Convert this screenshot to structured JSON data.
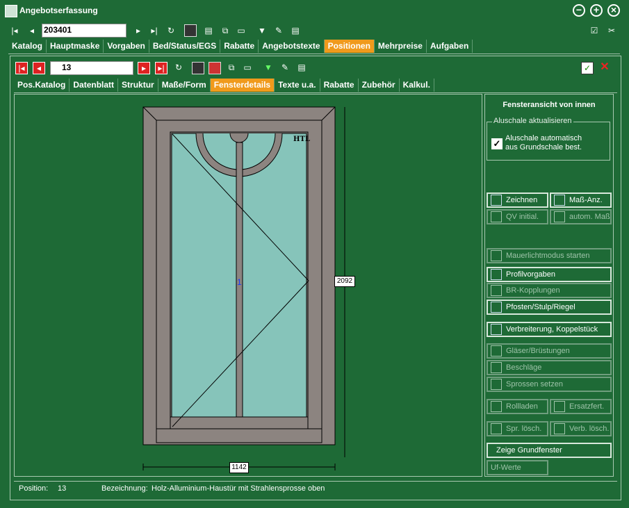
{
  "window": {
    "title": "Angebotserfassung",
    "icon": "app-icon"
  },
  "top_toolbar": {
    "record_number": "203401"
  },
  "main_tabs": [
    "Katalog",
    "Hauptmaske",
    "Vorgaben",
    "Bed/Status/EGS",
    "Rabatte",
    "Angebotstexte",
    "Positionen",
    "Mehrpreise",
    "Aufgaben"
  ],
  "position_toolbar": {
    "position_number": "13"
  },
  "sub_tabs": [
    "Pos.Katalog",
    "Datenblatt",
    "Struktur",
    "Maße/Form",
    "Fensterdetails",
    "Texte u.a.",
    "Rabatte",
    "Zubehör",
    "Kalkul."
  ],
  "drawing": {
    "glazing_label": "HTL",
    "field_number": "1",
    "height_dim": "2092",
    "width_dim": "1142"
  },
  "panel": {
    "title": "Fensteransicht von innen",
    "group_title": "Aluschale aktualisieren",
    "checkbox_label_line1": "Aluschale automatisch",
    "checkbox_label_line2": "aus Grundschale best.",
    "checkbox_checked": true,
    "btn_zeichnen": "Zeichnen",
    "btn_mass_anz": "Maß-Anz.",
    "btn_qv_initial": "QV initial.",
    "btn_autom_mass": "autom. Maß",
    "btn_mauerlicht": "Mauerlichtmodus starten",
    "btn_profilvorgaben": "Profilvorgaben",
    "btn_br_kopplungen": "BR-Kopplungen",
    "btn_pfosten": "Pfosten/Stulp/Riegel",
    "btn_verbreiterung": "Verbreiterung, Koppelstück",
    "btn_glaeser": "Gläser/Brüstungen",
    "btn_beschlaege": "Beschläge",
    "btn_sprossen": "Sprossen setzen",
    "btn_rollladen": "Rollladen",
    "btn_ersatzfert": "Ersatzfert.",
    "btn_spr_loesch": "Spr. lösch.",
    "btn_verb_loesch": "Verb. lösch.",
    "btn_grundfenster": "Zeige Grundfenster",
    "btn_uf_werte": "Uf-Werte"
  },
  "status": {
    "position_label": "Position:",
    "position_value": "13",
    "bezeichnung_label": "Bezeichnung:",
    "bezeichnung_value": "Holz-Alluminium-Haustür mit Strahlensprosse oben"
  },
  "colors": {
    "accent_tab": "#f09a1c",
    "background": "#1e6a36",
    "glass": "#86c4ba",
    "frame": "#8c8480"
  }
}
